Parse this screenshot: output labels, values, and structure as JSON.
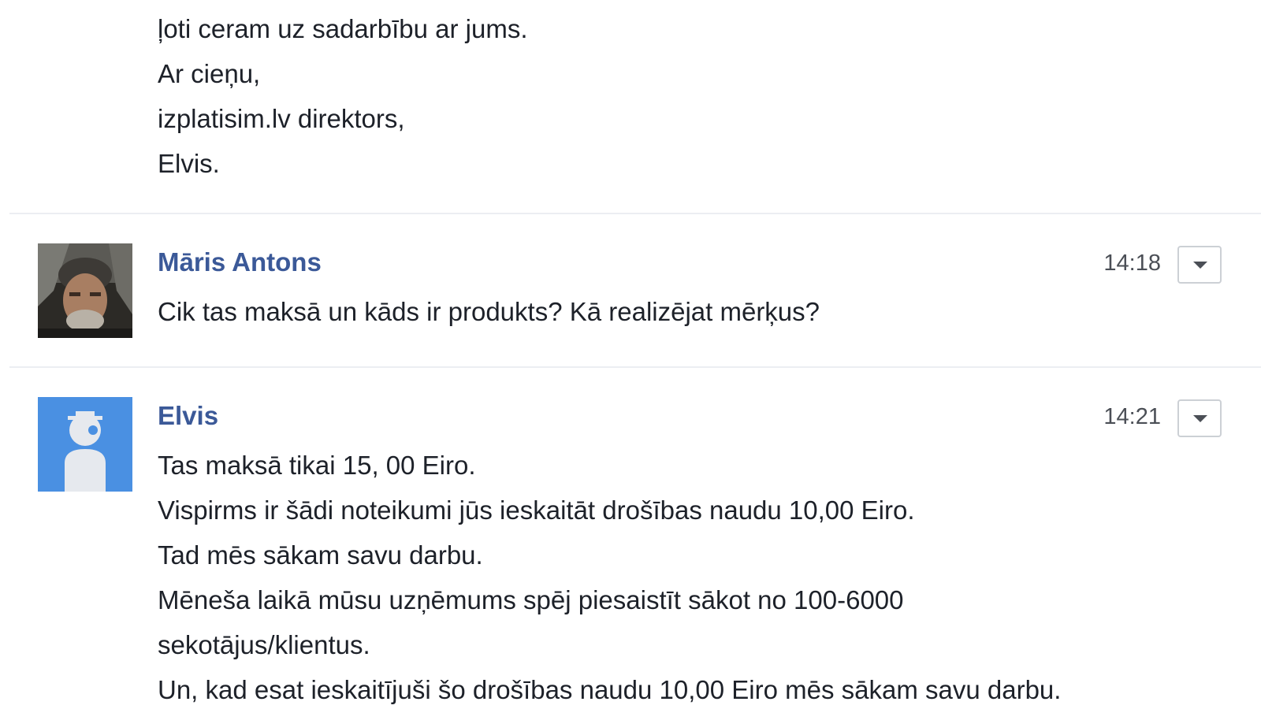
{
  "previous_message": {
    "lines": [
      "ļoti ceram uz sadarbību ar jums.",
      "Ar cieņu,",
      "izplatisim.lv direktors,",
      "Elvis."
    ]
  },
  "messages": [
    {
      "author": "Māris Antons",
      "time": "14:18",
      "avatar": "user-photo",
      "lines": [
        "Cik tas maksā un kāds ir produkts? Kā realizējat mērķus?"
      ]
    },
    {
      "author": "Elvis",
      "time": "14:21",
      "avatar": "default-user-avatar",
      "lines": [
        "Tas maksā tikai 15, 00 Eiro.",
        "Vispirms ir šādi noteikumi jūs ieskaitāt drošības naudu 10,00 Eiro.",
        "Tad mēs sākam savu darbu.",
        "Mēneša laikā mūsu uzņēmums spēj piesaistīt sākot no 100-6000",
        "sekotājus/klientus.",
        "Un, kad esat ieskaitījuši šo drošības naudu 10,00 Eiro mēs sākam savu darbu."
      ]
    }
  ],
  "icons": {
    "message_menu": "caret-down-icon"
  },
  "colors": {
    "author_name": "#3b5998",
    "message_text": "#1d2129",
    "timestamp": "#4b4f56",
    "divider": "#eceef2",
    "default_avatar_bg": "#4a90e2"
  }
}
